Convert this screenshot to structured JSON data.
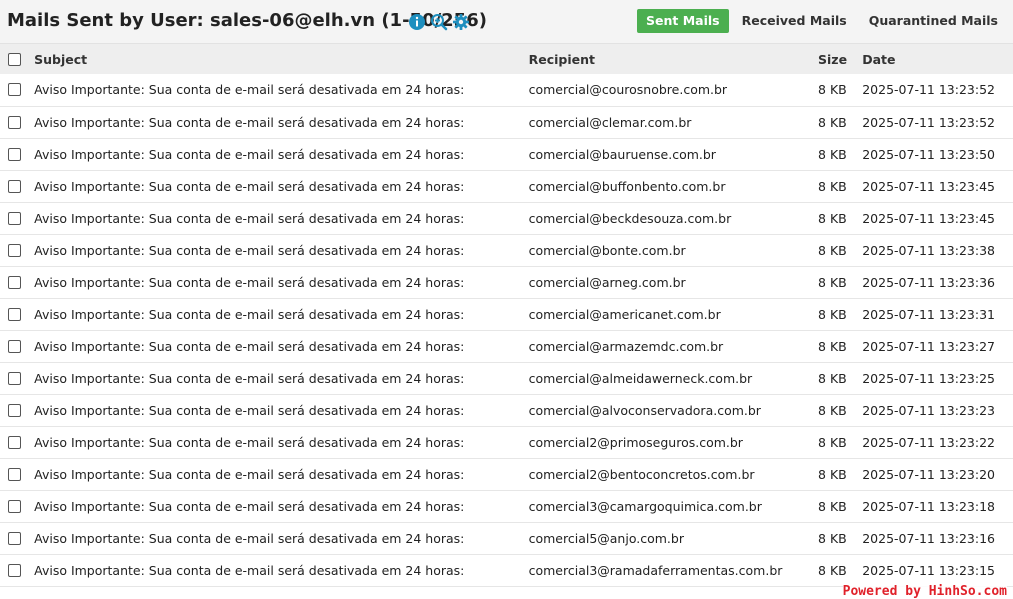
{
  "header": {
    "title": "Mails Sent by User: sales-06@elh.vn (1-50/256)",
    "icons": [
      "info-icon",
      "zoom-in-icon",
      "gear-icon"
    ],
    "tabs": [
      {
        "label": "Sent Mails",
        "active": true
      },
      {
        "label": "Received Mails",
        "active": false
      },
      {
        "label": "Quarantined Mails",
        "active": false
      }
    ]
  },
  "colors": {
    "accent": "#4caf50",
    "icon": "#1e8fbf",
    "watermark": "#e0212a"
  },
  "table": {
    "columns": {
      "subject": "Subject",
      "recipient": "Recipient",
      "size": "Size",
      "date": "Date"
    },
    "rows": [
      {
        "subject": "Aviso Importante: Sua conta de e-mail será desativada em 24 horas:",
        "recipient": "comercial@courosnobre.com.br",
        "size": "8 KB",
        "date": "2025-07-11 13:23:52"
      },
      {
        "subject": "Aviso Importante: Sua conta de e-mail será desativada em 24 horas:",
        "recipient": "comercial@clemar.com.br",
        "size": "8 KB",
        "date": "2025-07-11 13:23:52"
      },
      {
        "subject": "Aviso Importante: Sua conta de e-mail será desativada em 24 horas:",
        "recipient": "comercial@bauruense.com.br",
        "size": "8 KB",
        "date": "2025-07-11 13:23:50"
      },
      {
        "subject": "Aviso Importante: Sua conta de e-mail será desativada em 24 horas:",
        "recipient": "comercial@buffonbento.com.br",
        "size": "8 KB",
        "date": "2025-07-11 13:23:45"
      },
      {
        "subject": "Aviso Importante: Sua conta de e-mail será desativada em 24 horas:",
        "recipient": "comercial@beckdesouza.com.br",
        "size": "8 KB",
        "date": "2025-07-11 13:23:45"
      },
      {
        "subject": "Aviso Importante: Sua conta de e-mail será desativada em 24 horas:",
        "recipient": "comercial@bonte.com.br",
        "size": "8 KB",
        "date": "2025-07-11 13:23:38"
      },
      {
        "subject": "Aviso Importante: Sua conta de e-mail será desativada em 24 horas:",
        "recipient": "comercial@arneg.com.br",
        "size": "8 KB",
        "date": "2025-07-11 13:23:36"
      },
      {
        "subject": "Aviso Importante: Sua conta de e-mail será desativada em 24 horas:",
        "recipient": "comercial@americanet.com.br",
        "size": "8 KB",
        "date": "2025-07-11 13:23:31"
      },
      {
        "subject": "Aviso Importante: Sua conta de e-mail será desativada em 24 horas:",
        "recipient": "comercial@armazemdc.com.br",
        "size": "8 KB",
        "date": "2025-07-11 13:23:27"
      },
      {
        "subject": "Aviso Importante: Sua conta de e-mail será desativada em 24 horas:",
        "recipient": "comercial@almeidawerneck.com.br",
        "size": "8 KB",
        "date": "2025-07-11 13:23:25"
      },
      {
        "subject": "Aviso Importante: Sua conta de e-mail será desativada em 24 horas:",
        "recipient": "comercial@alvoconservadora.com.br",
        "size": "8 KB",
        "date": "2025-07-11 13:23:23"
      },
      {
        "subject": "Aviso Importante: Sua conta de e-mail será desativada em 24 horas:",
        "recipient": "comercial2@primoseguros.com.br",
        "size": "8 KB",
        "date": "2025-07-11 13:23:22"
      },
      {
        "subject": "Aviso Importante: Sua conta de e-mail será desativada em 24 horas:",
        "recipient": "comercial2@bentoconcretos.com.br",
        "size": "8 KB",
        "date": "2025-07-11 13:23:20"
      },
      {
        "subject": "Aviso Importante: Sua conta de e-mail será desativada em 24 horas:",
        "recipient": "comercial3@camargoquimica.com.br",
        "size": "8 KB",
        "date": "2025-07-11 13:23:18"
      },
      {
        "subject": "Aviso Importante: Sua conta de e-mail será desativada em 24 horas:",
        "recipient": "comercial5@anjo.com.br",
        "size": "8 KB",
        "date": "2025-07-11 13:23:16"
      },
      {
        "subject": "Aviso Importante: Sua conta de e-mail será desativada em 24 horas:",
        "recipient": "comercial3@ramadaferramentas.com.br",
        "size": "8 KB",
        "date": "2025-07-11 13:23:15"
      }
    ]
  },
  "watermark": "Powered by HinhSo.com"
}
